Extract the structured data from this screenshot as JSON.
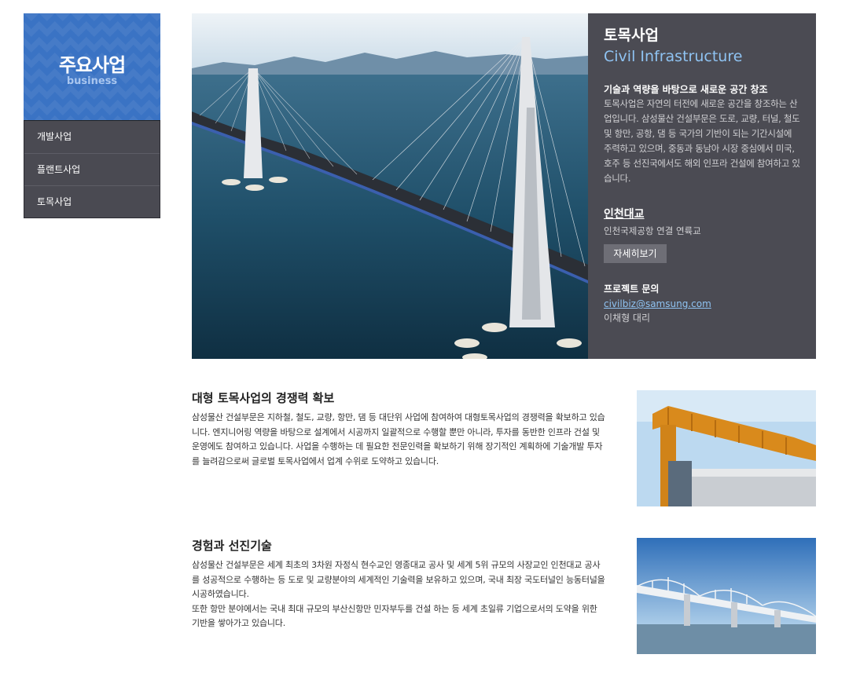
{
  "sidebar": {
    "title": "주요사업",
    "subtitle": "business",
    "items": [
      {
        "label": "개발사업"
      },
      {
        "label": "플랜트사업"
      },
      {
        "label": "토목사업"
      }
    ]
  },
  "hero": {
    "title": "토목사업",
    "subtitle": "Civil Infrastructure",
    "heading": "기술과 역량을 바탕으로 새로운 공간 창조",
    "description": "토목사업은 자연의 터전에 새로운 공간을 창조하는 산업입니다. 삼성물산 건설부문은 도로, 교량, 터널, 철도 및 항만, 공항, 댐 등 국가의 기반이 되는 기간시설에 주력하고 있으며, 중동과 동남아 시장 중심에서 미국, 호주 등 선진국에서도 해외 인프라 건설에 참여하고 있습니다.",
    "project_name": "인천대교",
    "project_desc": "인천국제공항 연결 연륙교",
    "detail_button": "자세히보기",
    "contact_heading": "프로젝트 문의",
    "contact_email": "civilbiz@samsung.com",
    "contact_person": "이채형 대리"
  },
  "sections": [
    {
      "title": "대형 토목사업의 경쟁력 확보",
      "text": "삼성물산 건설부문은 지하철, 철도, 교량, 항만, 댐 등 대단위 사업에 참여하여 대형토목사업의 경쟁력을 확보하고 있습니다. 엔지니어링 역량을 바탕으로 설계에서 시공까지 일괄적으로 수행할 뿐만 아니라, 투자를 동반한 인프라 건설 및 운영에도 참여하고 있습니다. 사업을 수행하는 데 필요한 전문인력을 확보하기 위해 장기적인 계획하에 기술개발 투자를 늘려감으로써 글로벌 토목사업에서 업계 수위로 도약하고 있습니다."
    },
    {
      "title": "경험과 선진기술",
      "text_lines": [
        "삼성물산 건설부문은 세계 최초의 3차원 자정식 현수교인 영종대교 공사 및 세계 5위 규모의 사장교인 인천대교 공사를 성공적으로 수행하는 등 도로 및 교량분야의 세계적인 기술력을 보유하고 있으며, 국내 최장 국도터널인 능동터널을 시공하였습니다.",
        "또한 항만 분야에서는 국내 최대 규모의 부산신항만 민자부두를 건설 하는 등 세계 초일류 기업으로서의 도약을 위한 기반을 쌓아가고 있습니다."
      ]
    }
  ],
  "colors": {
    "sidebar_header": "#3a73c4",
    "sidebar_menu": "#4a4a52",
    "hero_panel": "#4b4b53",
    "accent_blue": "#8fc3f2"
  }
}
